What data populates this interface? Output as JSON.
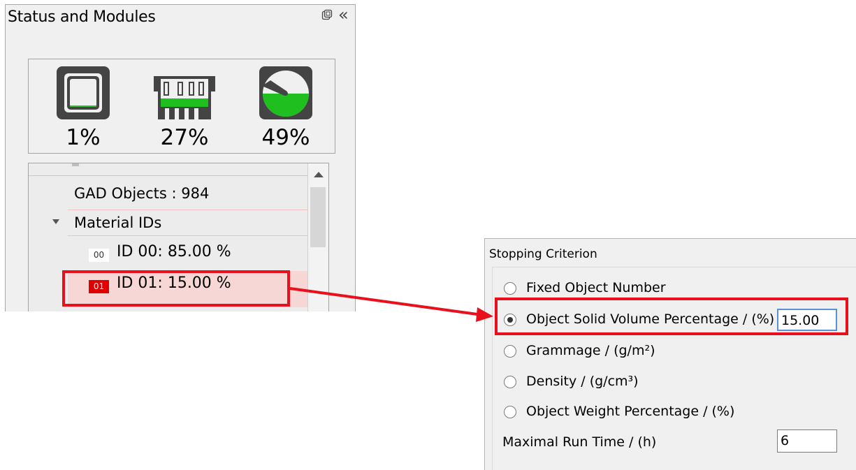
{
  "status_panel": {
    "title": "Status and Modules",
    "float_icon": "restore-window-icon",
    "collapse_icon": "double-chevron-left-icon",
    "resources": [
      {
        "name": "cpu",
        "icon": "cpu-chip-icon",
        "value": "1%"
      },
      {
        "name": "memory",
        "icon": "memory-module-icon",
        "value": "27%"
      },
      {
        "name": "disk",
        "icon": "hard-disk-icon",
        "value": "49%"
      }
    ],
    "tree": {
      "gad_objects": "GAD Objects : 984",
      "material_ids": "Material IDs",
      "items": [
        {
          "badge": "00",
          "label": "ID 00: 85.00 %",
          "color": "#ffffff"
        },
        {
          "badge": "01",
          "label": "ID 01: 15.00 %",
          "color": "#e00000"
        }
      ]
    }
  },
  "stopping_criterion": {
    "title": "Stopping Criterion",
    "options": [
      {
        "label": "Fixed Object Number",
        "selected": false
      },
      {
        "label": "Object Solid Volume Percentage / (%)",
        "selected": true
      },
      {
        "label": "Grammage / (g/m²)",
        "selected": false
      },
      {
        "label": "Density / (g/cm³)",
        "selected": false
      },
      {
        "label": "Object Weight Percentage / (%)",
        "selected": false
      }
    ],
    "volume_value": "15.00",
    "max_run_label": "Maximal Run Time / (h)",
    "max_run_value": "6"
  },
  "highlight_color": "#e8101c"
}
